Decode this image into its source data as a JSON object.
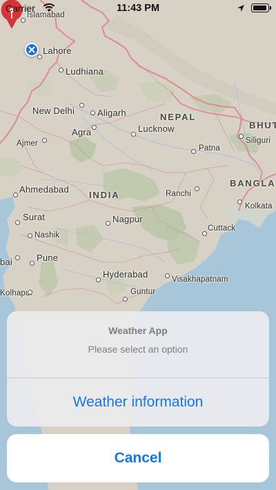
{
  "status_bar": {
    "carrier": "Carrier",
    "time": "11:43 PM",
    "wifi_icon": "wifi-icon",
    "location_icon": "location-arrow-icon",
    "battery_icon": "battery-icon"
  },
  "map": {
    "countries": {
      "nepal": "NEPAL",
      "india": "INDIA",
      "bhutan": "BHUT",
      "bangladesh": "BANGLA"
    },
    "cities": {
      "islamabad": "Islamabad",
      "lahore": "Lahore",
      "ludhiana": "Ludhiana",
      "new_delhi": "New Delhi",
      "aligarh": "Aligarh",
      "agra": "Agra",
      "lucknow": "Lucknow",
      "ajmer": "Ajmer",
      "patna": "Patna",
      "siliguri": "Siliguri",
      "ahmedabad": "Ahmedabad",
      "ranchi": "Ranchi",
      "kolkata": "Kolkata",
      "surat": "Surat",
      "nagpur": "Nagpur",
      "nashik": "Nashik",
      "cuttack": "Cuttack",
      "mumbai": "bai",
      "pune": "Pune",
      "hyderabad": "Hyderabad",
      "visakhapatnam": "Visakhapatnam",
      "kolhapur": "Kolhapur",
      "guntur": "Guntur"
    },
    "colors": {
      "land": "#d9d3c7",
      "water": "#a6c6da",
      "border": "#dc8f95",
      "pin": "#d9343a",
      "user_location": "#1a6fe0"
    }
  },
  "action_sheet": {
    "title": "Weather App",
    "message": "Please select an option",
    "action_label": "Weather information",
    "cancel_label": "Cancel",
    "accent_color": "#1677e8"
  }
}
